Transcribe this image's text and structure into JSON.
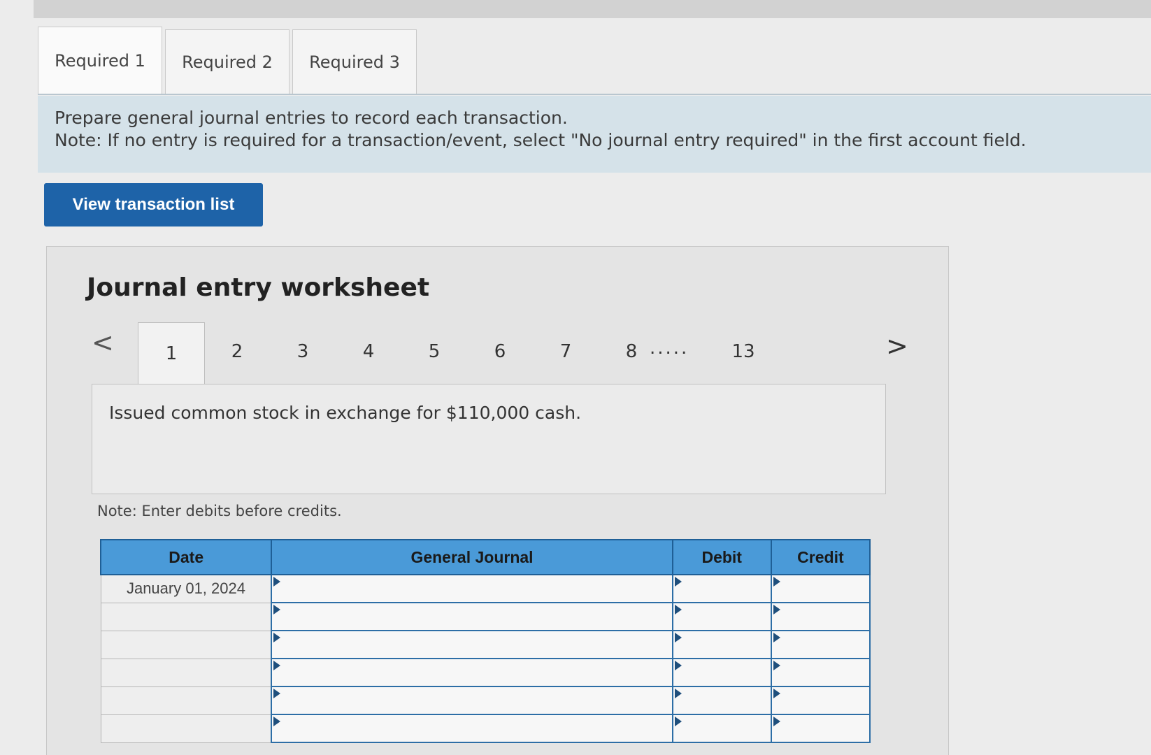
{
  "tabs": [
    {
      "label": "Required 1"
    },
    {
      "label": "Required 2"
    },
    {
      "label": "Required 3"
    }
  ],
  "instructions": {
    "line1": "Prepare general journal entries to record each transaction.",
    "line2": "Note: If no entry is required for a transaction/event, select \"No journal entry required\" in the first account field."
  },
  "view_button": "View transaction list",
  "worksheet": {
    "title": "Journal entry worksheet",
    "prev": "<",
    "next": ">",
    "steps": [
      "1",
      "2",
      "3",
      "4",
      "5",
      "6",
      "7",
      "8"
    ],
    "ellipsis": ".....",
    "last_step": "13",
    "description": "Issued common stock in exchange for $110,000 cash.",
    "note": "Note: Enter debits before credits."
  },
  "table": {
    "headers": [
      "Date",
      "General Journal",
      "Debit",
      "Credit"
    ],
    "rows": [
      {
        "date": "January 01, 2024"
      },
      {
        "date": ""
      },
      {
        "date": ""
      },
      {
        "date": ""
      },
      {
        "date": ""
      },
      {
        "date": ""
      }
    ]
  }
}
